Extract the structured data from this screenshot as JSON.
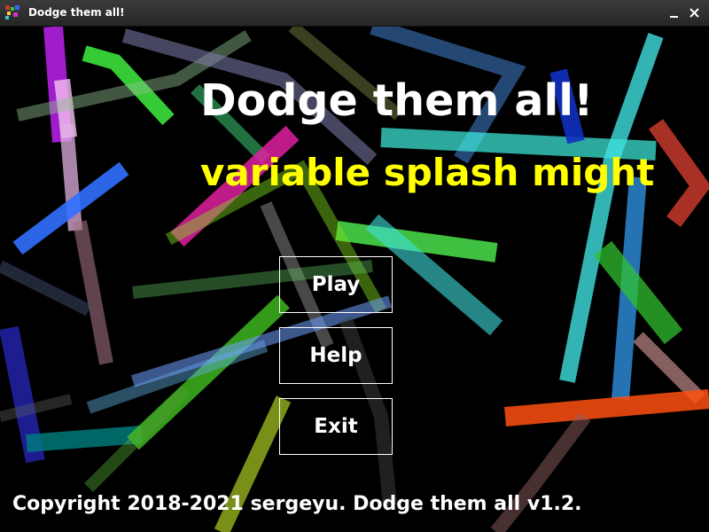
{
  "window": {
    "title": "Dodge them all!",
    "minimize_icon": "minimize-icon",
    "close_icon": "close-icon",
    "app_icon": "app-icon"
  },
  "game": {
    "title": "Dodge them all!",
    "splash": "variable splash might",
    "menu": {
      "play": "Play",
      "help": "Help",
      "exit": "Exit"
    },
    "copyright": "Copyright 2018-2021 sergeyu. Dodge them all v1.2."
  },
  "colors": {
    "background": "#000000",
    "title": "#ffffff",
    "splash": "#ffff00",
    "menu_border": "#ffffff"
  }
}
